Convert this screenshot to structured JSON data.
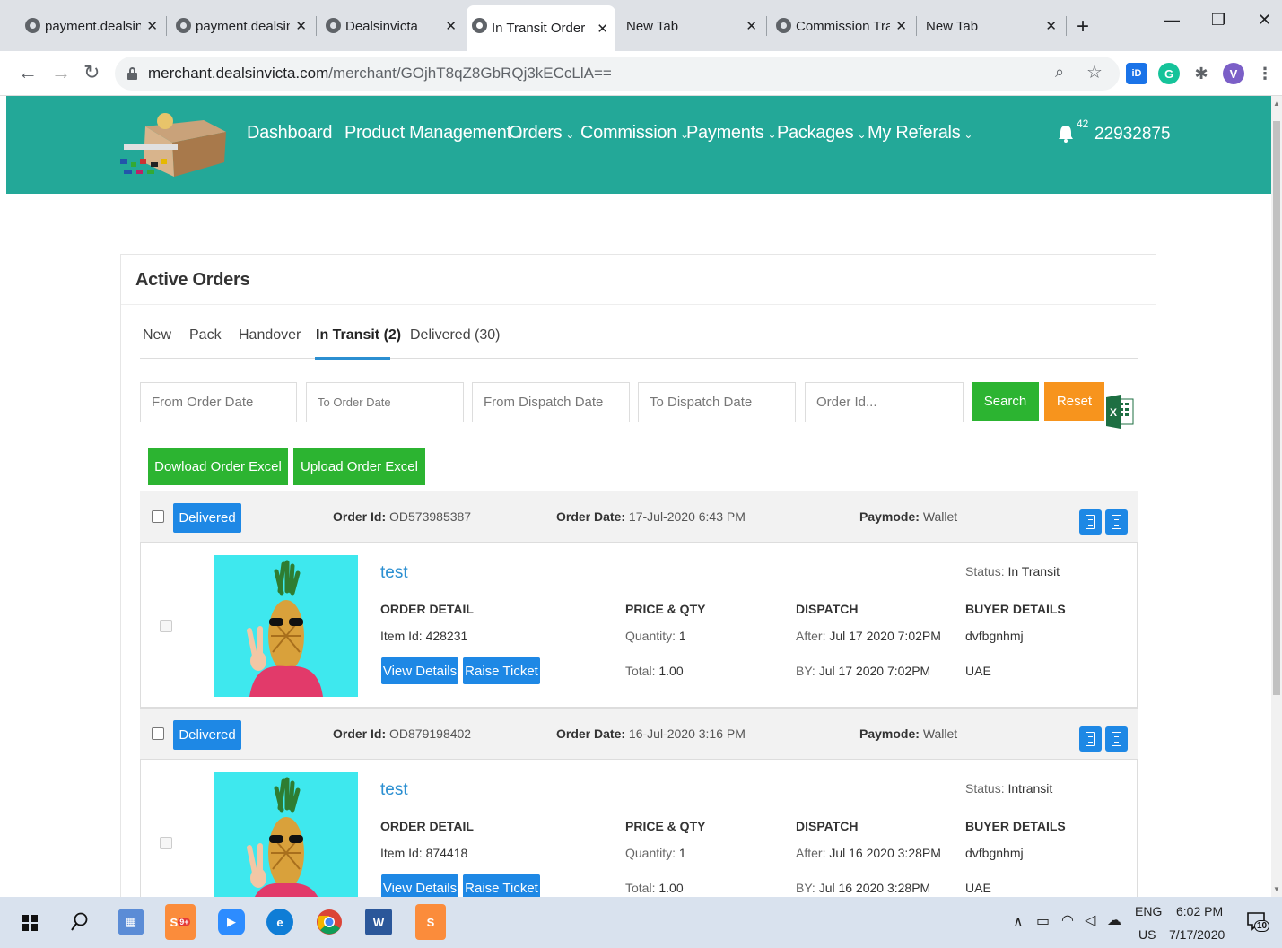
{
  "browser": {
    "tabs": [
      {
        "title": "payment.dealsin",
        "active": false
      },
      {
        "title": "payment.dealsin",
        "active": false
      },
      {
        "title": "Dealsinvicta",
        "active": false
      },
      {
        "title": "In Transit Order",
        "active": true
      },
      {
        "title": "New Tab",
        "active": false
      },
      {
        "title": "Commission Tra",
        "active": false
      },
      {
        "title": "New Tab",
        "active": false
      }
    ],
    "url_host": "merchant.dealsinvicta.com",
    "url_path": "/merchant/GOjhT8qZ8GbRQj3kECcLlA==",
    "profile_initial": "V",
    "ext_id_label": "iD",
    "ext_g_label": "G"
  },
  "site": {
    "nav": [
      "Dashboard",
      "Product Management",
      "Orders",
      "Commission",
      "Payments",
      "Packages",
      "My Referals"
    ],
    "notification_count": "42",
    "merchant_id": "22932875"
  },
  "panel": {
    "title": "Active Orders",
    "tabs": [
      "New",
      "Pack",
      "Handover",
      "In Transit (2)",
      "Delivered (30)"
    ],
    "active_tab": "In Transit (2)",
    "filters": {
      "from_order_date": "From Order Date",
      "to_order_date": "To Order Date",
      "from_dispatch_date": "From Dispatch Date",
      "to_dispatch_date": "To Dispatch Date",
      "order_id": "Order Id..."
    },
    "search_label": "Search",
    "reset_label": "Reset",
    "download_excel_label": "Dowload Order Excel",
    "upload_excel_label": "Upload Order Excel",
    "labels": {
      "order_id": "Order Id:",
      "order_date": "Order Date:",
      "paymode": "Paymode:",
      "order_detail": "ORDER DETAIL",
      "price_qty": "PRICE & QTY",
      "dispatch": "DISPATCH",
      "buyer_details": "BUYER DETAILS",
      "view_details": "View Details",
      "raise_ticket": "Raise Ticket"
    },
    "orders": [
      {
        "status_button": "Delivered",
        "order_id": "OD573985387",
        "order_date": "17-Jul-2020 6:43 PM",
        "paymode": "Wallet",
        "product_name": "test",
        "status_label": "Status:",
        "status_value": "In Transit",
        "item_id": "Item Id: 428231",
        "quantity_label": "Quantity:",
        "quantity": "1",
        "total_label": "Total:",
        "total": "1.00",
        "after_label": "After:",
        "after": "Jul 17 2020 7:02PM",
        "by_label": "BY:",
        "by": "Jul 17 2020 7:02PM",
        "buyer_name": "dvfbgnhmj",
        "buyer_country": "UAE"
      },
      {
        "status_button": "Delivered",
        "order_id": "OD879198402",
        "order_date": "16-Jul-2020 3:16 PM",
        "paymode": "Wallet",
        "product_name": "test",
        "status_label": "Status:",
        "status_value": "Intransit",
        "item_id": "Item Id: 874418",
        "quantity_label": "Quantity:",
        "quantity": "1",
        "total_label": "Total:",
        "total": "1.00",
        "after_label": "After:",
        "after": "Jul 16 2020 3:28PM",
        "by_label": "BY:",
        "by": "Jul 16 2020 3:28PM",
        "buyer_name": "dvfbgnhmj",
        "buyer_country": "UAE"
      }
    ]
  },
  "taskbar": {
    "lang_top": "ENG",
    "lang_bottom": "US",
    "time": "6:02 PM",
    "date": "7/17/2020",
    "notification_badge": "10",
    "skype_badge": "9+"
  },
  "colors": {
    "header_teal": "#23a898",
    "primary_blue": "#1e88e5",
    "search_green": "#2cb431",
    "reset_orange": "#f7941d",
    "link_blue": "#2b8fd1"
  }
}
